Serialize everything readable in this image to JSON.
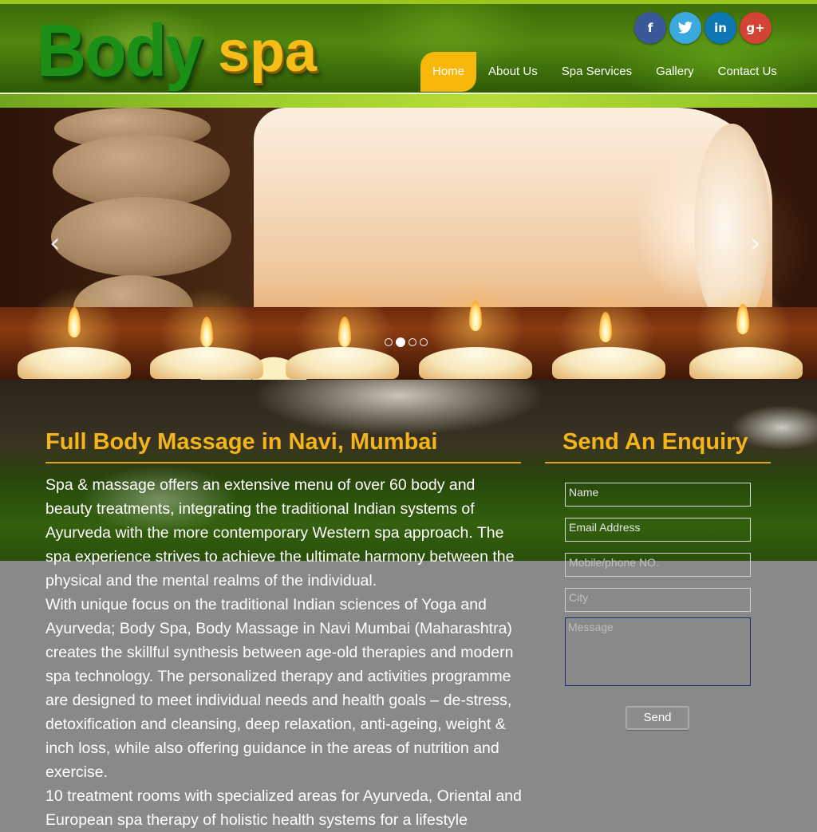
{
  "brand": {
    "logo_part1": "Body",
    "logo_part2": "spa"
  },
  "social": {
    "facebook_label": "f",
    "twitter_label": "🐦",
    "linkedin_label": "in",
    "googleplus_label": "g+"
  },
  "nav": {
    "items": [
      {
        "label": "Home",
        "active": true
      },
      {
        "label": "About Us"
      },
      {
        "label": "Spa Services"
      },
      {
        "label": "Gallery"
      },
      {
        "label": "Contact Us"
      }
    ]
  },
  "slider": {
    "prev_glyph": "‹",
    "next_glyph": "›",
    "slide_count": 4,
    "active_slide": 2
  },
  "main": {
    "title": "Full Body Massage in Navi, Mumbai",
    "paragraphs": [
      "Spa & massage offers an extensive menu of over 60 body and beauty treatments, integrating the traditional Indian systems of Ayurveda with the more contemporary Western spa approach. The spa experience strives to achieve the ultimate harmony between the physical and the mental realms of the individual.",
      "With unique focus on the traditional Indian sciences of Yoga and Ayurveda; Body Spa, Body Massage in Navi Mumbai (Maharashtra) creates the skillful synthesis between age-old therapies and modern spa technology. The personalized therapy and activities programme are designed to meet individual needs and health goals – de-stress, detoxification and cleansing, deep relaxation, anti-ageing, weight & inch loss, while also offering guidance in the areas of nutrition and exercise.",
      "10 treatment rooms with specialized areas for Ayurveda, Oriental and European spa therapy of holistic health systems for a lifestyle"
    ]
  },
  "enquiry": {
    "title": "Send An Enquiry",
    "name_placeholder": "Name",
    "email_placeholder": "Email Address",
    "mobile_placeholder": "Mobile/phone NO.",
    "city_placeholder": "City",
    "message_placeholder": "Message",
    "send_label": "Send"
  },
  "colors": {
    "accent": "#f4b51b",
    "header_green": "#4f8610",
    "nav_active": "#f8b70b"
  }
}
